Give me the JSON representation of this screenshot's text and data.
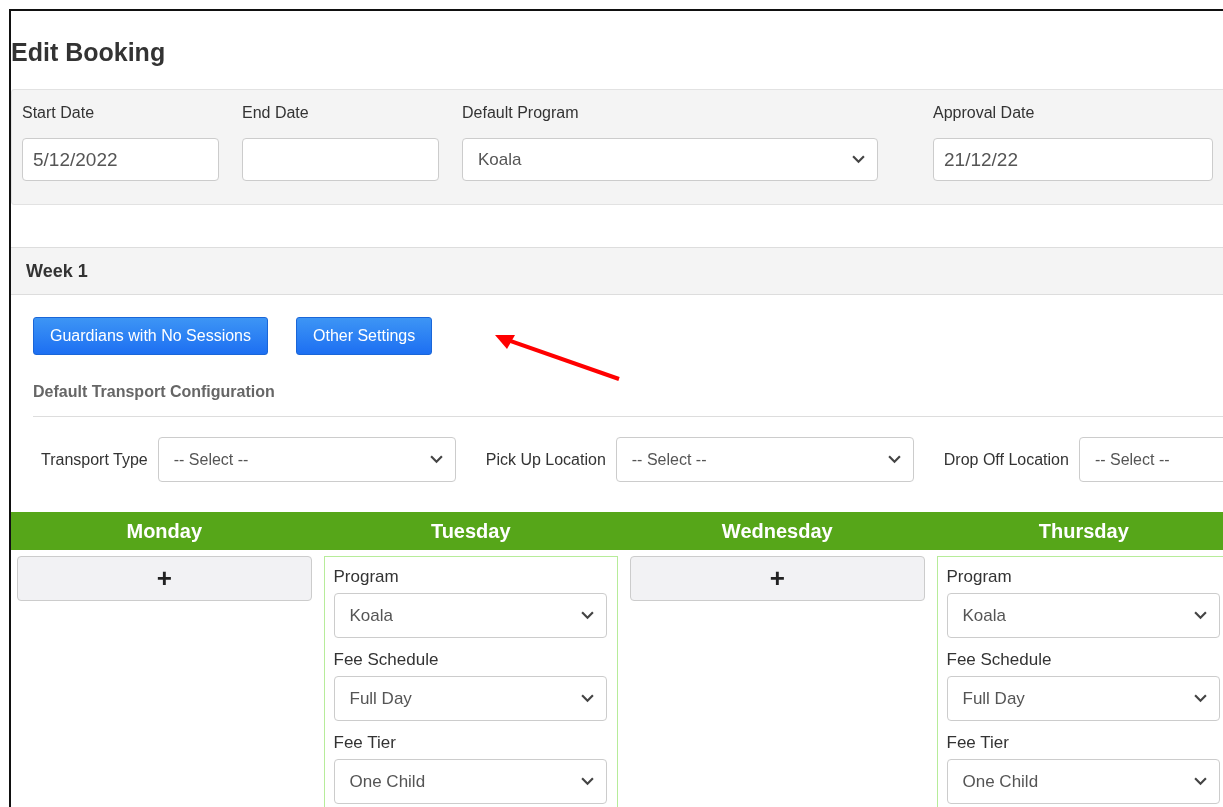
{
  "title": "Edit Booking",
  "booking_fields": [
    {
      "label": "Start Date",
      "kind": "text",
      "value": "5/12/2022"
    },
    {
      "label": "End Date",
      "kind": "text"
    },
    {
      "label": "Default Program",
      "kind": "select",
      "value": "Koala"
    },
    {
      "label": "Approval Date",
      "kind": "text",
      "value": "21/12/22"
    }
  ],
  "week": {
    "title": "Week 1",
    "buttons": [
      "Guardians with No Sessions",
      "Other Settings"
    ],
    "transport_heading": "Default Transport Configuration",
    "transport_fields": [
      {
        "label": "Transport Type",
        "value": "-- Select --"
      },
      {
        "label": "Pick Up Location",
        "value": "-- Select --"
      },
      {
        "label": "Drop Off Location",
        "value": "-- Select --"
      }
    ],
    "days": [
      {
        "name": "Monday",
        "kind": "empty",
        "add_label": "+"
      },
      {
        "name": "Tuesday",
        "kind": "session",
        "fields": [
          {
            "label": "Program",
            "value": "Koala"
          },
          {
            "label": "Fee Schedule",
            "value": "Full Day"
          },
          {
            "label": "Fee Tier",
            "value": "One Child"
          }
        ]
      },
      {
        "name": "Wednesday",
        "kind": "empty",
        "add_label": "+"
      },
      {
        "name": "Thursday",
        "kind": "session",
        "fields": [
          {
            "label": "Program",
            "value": "Koala"
          },
          {
            "label": "Fee Schedule",
            "value": "Full Day"
          },
          {
            "label": "Fee Tier",
            "value": "One Child"
          }
        ]
      }
    ]
  }
}
